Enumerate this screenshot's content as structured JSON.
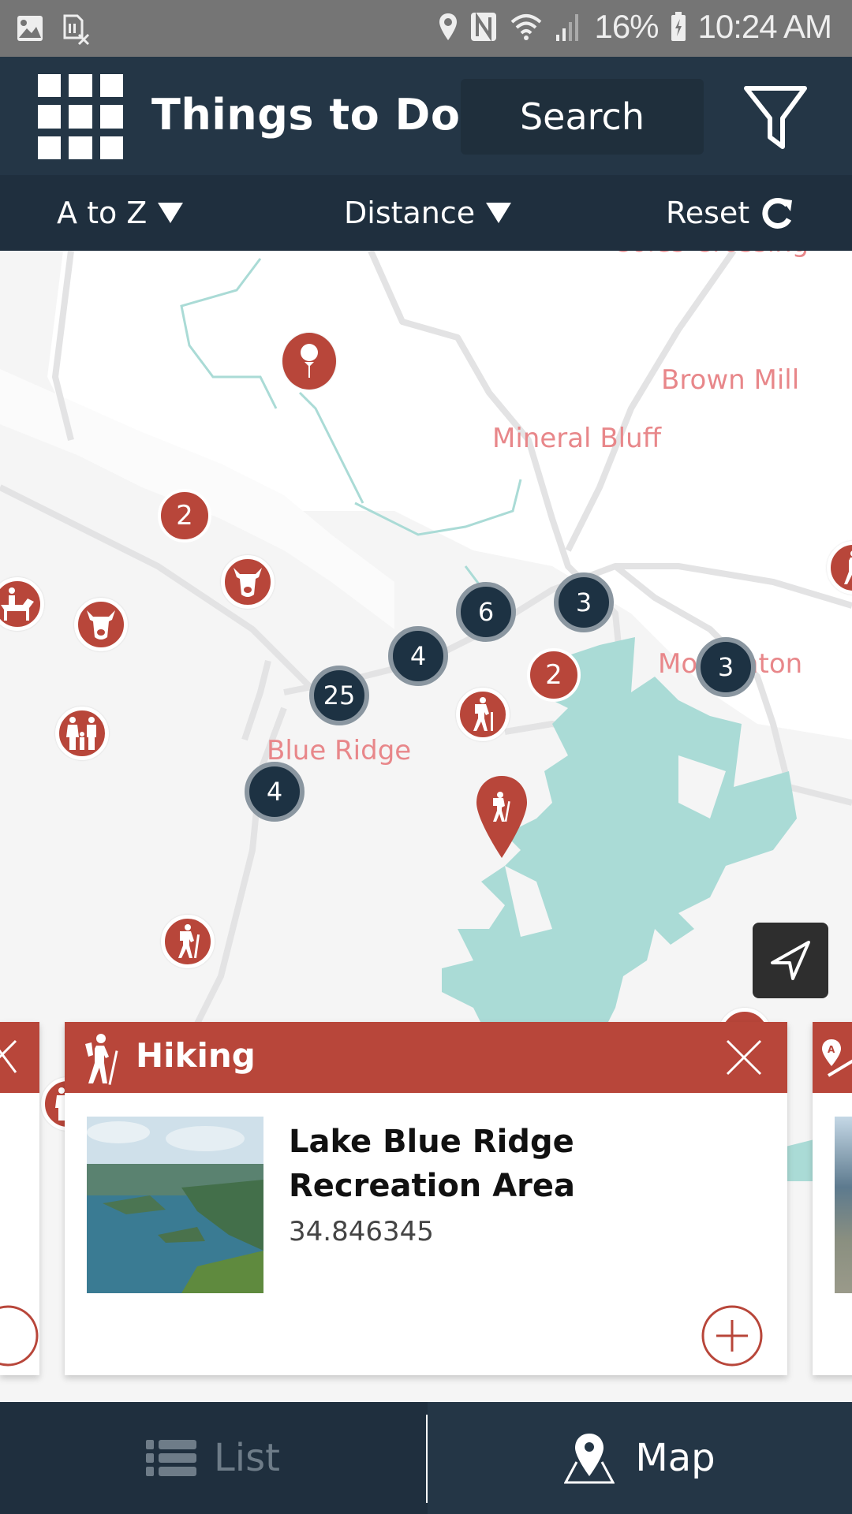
{
  "status_bar": {
    "battery": "16%",
    "time": "10:24 AM",
    "icons": [
      "image-icon",
      "no-sim-icon",
      "location-icon",
      "nfc-icon",
      "wifi-icon",
      "signal-icon",
      "battery-charging-icon"
    ]
  },
  "header": {
    "menu_icon": "grid-menu-icon",
    "title": "Things to Do",
    "search_label": "Search",
    "filter_icon": "filter-icon"
  },
  "sort_bar": {
    "alpha_label": "A to Z",
    "distance_label": "Distance",
    "reset_label": "Reset"
  },
  "map": {
    "place_labels": [
      "Coles Crossing",
      "Brown Mill",
      "Mineral Bluff",
      "Morganton",
      "Blue Ridge"
    ],
    "clusters_red": [
      "2",
      "2"
    ],
    "clusters_dark": [
      "6",
      "3",
      "4",
      "25",
      "4",
      "3"
    ],
    "poi_icons": [
      "golf-icon",
      "cow-icon",
      "cow-icon",
      "horseback-riding-icon",
      "family-icon",
      "hiking-icon",
      "hiking-icon",
      "hiking-icon",
      "family-icon"
    ],
    "selected_pin_icon": "hiking-icon",
    "locate_button_icon": "navigation-arrow-icon"
  },
  "card": {
    "category": "Hiking",
    "name": "Lake Blue Ridge Recreation Area",
    "coordinate": "34.846345",
    "category_icon": "hiking-icon",
    "close_icon": "close-icon",
    "add_icon": "plus-circle-icon",
    "next_card_icon": "route-a-to-b-icon"
  },
  "colors": {
    "header_bg": "#243646",
    "accent_red": "#b8463a",
    "cluster_dark": "#1d3243",
    "water": "#aadbd6",
    "place_label": "#e8878a"
  },
  "bottom_nav": {
    "list_label": "List",
    "map_label": "Map",
    "active": "Map"
  }
}
